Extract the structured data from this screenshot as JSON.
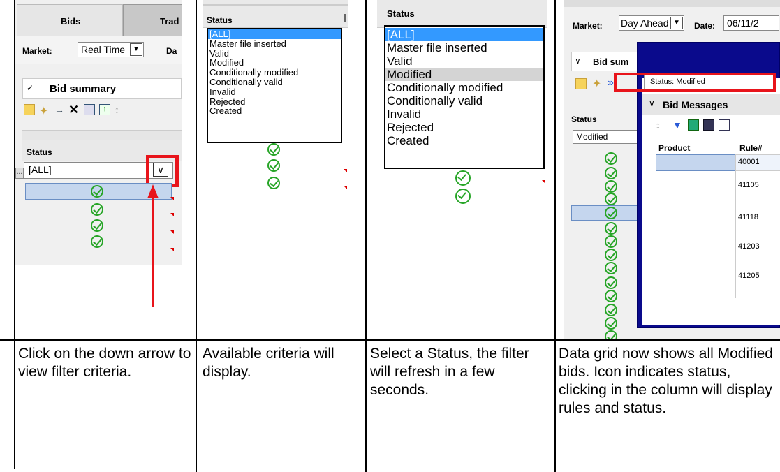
{
  "panel1": {
    "tab_bids": "Bids",
    "tab_trades": "Trad",
    "market_label": "Market:",
    "market_value": "Real Time",
    "date_label": "Da",
    "bid_summary": "Bid summary",
    "status_header": "Status",
    "filter_value": "[ALL]",
    "ellipsis": "..."
  },
  "panel2": {
    "status_header": "Status",
    "filter_options": [
      "[ALL]",
      "Master file inserted",
      "Valid",
      "Modified",
      "Conditionally modified",
      "Conditionally valid",
      "Invalid",
      "Rejected",
      "Created"
    ]
  },
  "panel3": {
    "status_header": "Status",
    "filter_options": [
      "[ALL]",
      "Master file inserted",
      "Valid",
      "Modified",
      "Conditionally modified",
      "Conditionally valid",
      "Invalid",
      "Rejected",
      "Created"
    ],
    "highlighted": "Modified"
  },
  "panel4": {
    "market_label": "Market:",
    "market_value": "Day Ahead",
    "date_label": "Date:",
    "date_value": "06/11/2",
    "bid_summary": "Bid sum",
    "status_header": "Status",
    "status_value": "Modified",
    "tooltip": "Status: Modified",
    "bid_messages": "Bid Messages",
    "col_product": "Product",
    "col_rule": "Rule#",
    "rules": [
      "40001",
      "41105",
      "41118",
      "41203",
      "41205"
    ]
  },
  "captions": [
    "Click on the down arrow to view filter criteria.",
    "Available criteria will display.",
    "Select a Status, the filter will refresh in a few seconds.",
    "Data grid now shows all Modified bids. Icon indicates status, clicking in the column will display rules and status."
  ],
  "colors": {
    "accent_red": "#e8141b",
    "check_green": "#27a527",
    "selection_blue": "#3399ff",
    "header_gray": "#e9e9e9",
    "dark_blue": "#0a0a8c"
  }
}
